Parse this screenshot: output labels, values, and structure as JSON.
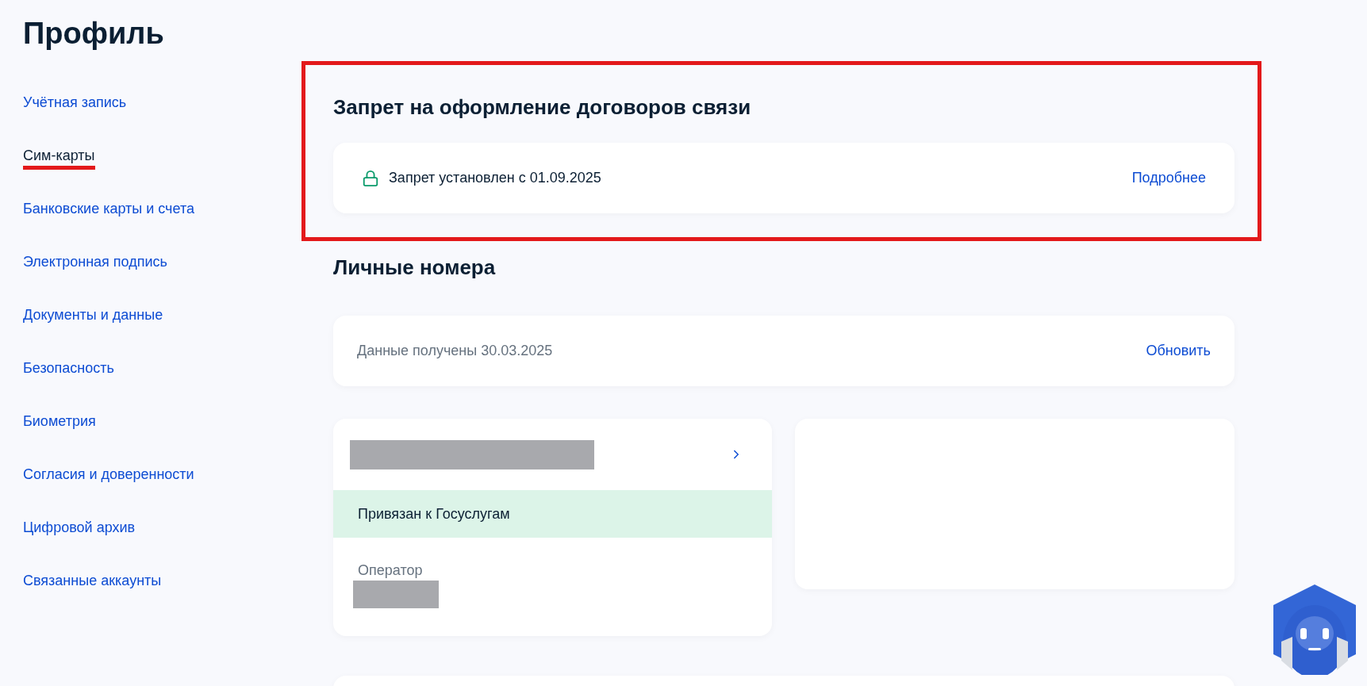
{
  "page_title": "Профиль",
  "sidebar": {
    "items": [
      {
        "label": "Учётная запись",
        "selected": false
      },
      {
        "label": "Сим-карты",
        "selected": true
      },
      {
        "label": "Банковские карты и счета",
        "selected": false
      },
      {
        "label": "Электронная подпись",
        "selected": false
      },
      {
        "label": "Документы и данные",
        "selected": false
      },
      {
        "label": "Безопасность",
        "selected": false
      },
      {
        "label": "Биометрия",
        "selected": false
      },
      {
        "label": "Согласия и доверенности",
        "selected": false
      },
      {
        "label": "Цифровой архив",
        "selected": false
      },
      {
        "label": "Связанные аккаунты",
        "selected": false
      }
    ]
  },
  "ban_section": {
    "highlighted": true,
    "title": "Запрет на оформление договоров связи",
    "status": "Запрет установлен с 01.09.2025",
    "link": "Подробнее"
  },
  "personal_numbers": {
    "title": "Личные номера",
    "data_notice": "Данные получены 30.03.2025",
    "refresh_link": "Обновить",
    "sim_card": {
      "linked_status": "Привязан к Госуслугам",
      "operator_label": "Оператор"
    }
  }
}
